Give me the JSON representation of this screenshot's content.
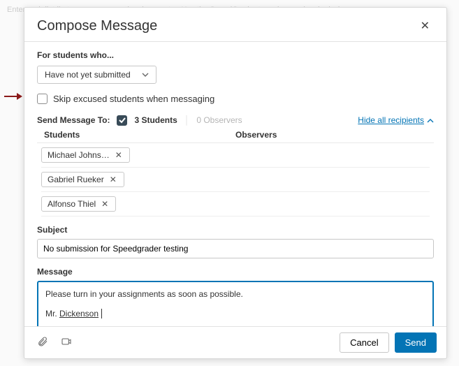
{
  "background": {
    "text": "Enter and distribute scores across the class roster. Use the SpeedGrader to review each submission."
  },
  "modal": {
    "title": "Compose Message",
    "filter": {
      "label": "For students who...",
      "selected": "Have not yet submitted"
    },
    "skip_excused": {
      "checked": false,
      "label": "Skip excused students when messaging"
    },
    "send_to": {
      "label": "Send Message To:",
      "students_checked": true,
      "students_count_label": "3 Students",
      "observers_count_label": "0 Observers",
      "hide_link": "Hide all recipients"
    },
    "columns": {
      "students": "Students",
      "observers": "Observers"
    },
    "recipients": [
      {
        "name": "Michael Johns…"
      },
      {
        "name": "Gabriel Rueker"
      },
      {
        "name": "Alfonso Thiel"
      }
    ],
    "subject": {
      "label": "Subject",
      "value": "No submission for Speedgrader testing"
    },
    "message": {
      "label": "Message",
      "line1": "Please turn in your assignments as soon as possible.",
      "line2_prefix": "Mr. ",
      "line2_name": "Dickenson"
    },
    "footer": {
      "cancel": "Cancel",
      "send": "Send"
    }
  }
}
